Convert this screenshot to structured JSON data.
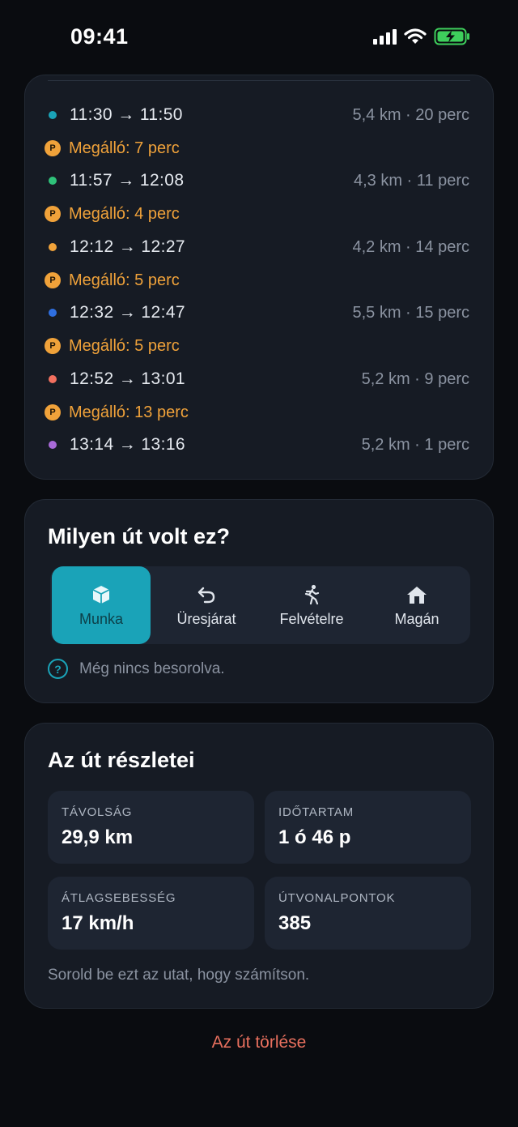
{
  "status_bar": {
    "time": "09:41"
  },
  "timeline": [
    {
      "kind": "segment",
      "color": "#1aa3b8",
      "time": "11:30 → 11:50",
      "meta": "5,4 km · 20 perc"
    },
    {
      "kind": "stop",
      "label": "Megálló: 7 perc",
      "badge": "P"
    },
    {
      "kind": "segment",
      "color": "#2fc27a",
      "time": "11:57 → 12:08",
      "meta": "4,3 km · 11 perc"
    },
    {
      "kind": "stop",
      "label": "Megálló: 4 perc",
      "badge": "P"
    },
    {
      "kind": "segment",
      "color": "#f0a23a",
      "time": "12:12 → 12:27",
      "meta": "4,2 km · 14 perc"
    },
    {
      "kind": "stop",
      "label": "Megálló: 5 perc",
      "badge": "P"
    },
    {
      "kind": "segment",
      "color": "#2f6fe0",
      "time": "12:32 → 12:47",
      "meta": "5,5 km · 15 perc"
    },
    {
      "kind": "stop",
      "label": "Megálló: 5 perc",
      "badge": "P"
    },
    {
      "kind": "segment",
      "color": "#f2705f",
      "time": "12:52 → 13:01",
      "meta": "5,2 km · 9 perc"
    },
    {
      "kind": "stop",
      "label": "Megálló: 13 perc",
      "badge": "P"
    },
    {
      "kind": "segment",
      "color": "#a86ad8",
      "time": "13:14 → 13:16",
      "meta": "5,2 km · 1 perc"
    }
  ],
  "trip_type": {
    "title": "Milyen út volt ez?",
    "options": [
      {
        "label": "Munka",
        "icon": "box-icon",
        "selected": true
      },
      {
        "label": "Üresjárat",
        "icon": "undo-arrow-icon",
        "selected": false
      },
      {
        "label": "Felvételre",
        "icon": "running-person-icon",
        "selected": false
      },
      {
        "label": "Magán",
        "icon": "house-icon",
        "selected": false
      }
    ],
    "hint": "Még nincs besorolva.",
    "hint_icon": "question-circle-icon"
  },
  "details": {
    "title": "Az út részletei",
    "stats": [
      {
        "label": "TÁVOLSÁG",
        "value": "29,9 km"
      },
      {
        "label": "IDŐTARTAM",
        "value": "1 ó 46 p"
      },
      {
        "label": "ÁTLAGSEBESSÉG",
        "value": "17 km/h"
      },
      {
        "label": "ÚTVONALPONTOK",
        "value": "385"
      }
    ],
    "footnote": "Sorold be ezt az utat, hogy számítson."
  },
  "delete_label": "Az út törlése",
  "colors": {
    "accent": "#1aa3b8",
    "stop": "#f0a23a",
    "danger": "#e8705e",
    "card": "#161b24"
  }
}
